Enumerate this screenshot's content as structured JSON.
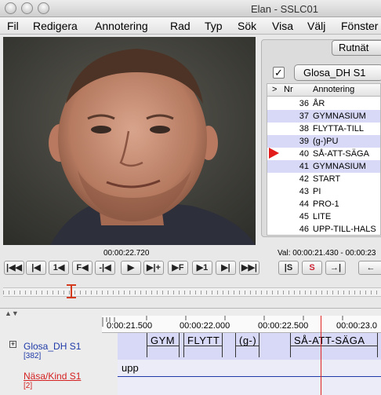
{
  "window": {
    "title": "Elan - SSLC01"
  },
  "menu": [
    "Fil",
    "Redigera",
    "Annotering",
    "Rad",
    "Typ",
    "Sök",
    "Visa",
    "Välj",
    "Fönster"
  ],
  "panel": {
    "tab_label": "Rutnät",
    "checkbox_mark": "✓",
    "tier_select": "Glosa_DH S1",
    "columns": {
      "marker": ">",
      "nr": "Nr",
      "annotation": "Annotering"
    },
    "rows": [
      {
        "nr": "36",
        "annotation": "ÅR"
      },
      {
        "nr": "37",
        "annotation": "GYMNASIUM"
      },
      {
        "nr": "38",
        "annotation": "FLYTTA-TILL"
      },
      {
        "nr": "39",
        "annotation": "(g-)PU"
      },
      {
        "nr": "40",
        "annotation": "SÅ-ATT-SÄGA"
      },
      {
        "nr": "41",
        "annotation": "GYMNASIUM"
      },
      {
        "nr": "42",
        "annotation": "START"
      },
      {
        "nr": "43",
        "annotation": "PI"
      },
      {
        "nr": "44",
        "annotation": "PRO-1"
      },
      {
        "nr": "45",
        "annotation": "LITE"
      },
      {
        "nr": "46",
        "annotation": "UPP-TILL-HALS"
      }
    ],
    "active_row": "40"
  },
  "media": {
    "current_time": "00:00:22.720",
    "selection": "Val: 00:00:21.430 - 00:00:23"
  },
  "controls": {
    "frame_back_label": "F",
    "frame_forward_label": "F",
    "one_back_label": "1",
    "one_forward_label": "1",
    "sel_s_label": "S",
    "sel_s2_label": "S"
  },
  "timeline": {
    "ruler_ticks": [
      "0:00:21.500",
      "00:00:22.000",
      "00:00:22.500",
      "00:00:23.0"
    ],
    "tiers": [
      {
        "name": "Glosa_DH S1",
        "count": "[382]",
        "color": "#1f3aa8"
      },
      {
        "name": "Näsa/Kind S1",
        "count": "[2]",
        "color": "#d42020"
      }
    ],
    "segments": [
      "GYM",
      "FLYTT",
      "(g-)",
      "SÅ-ATT-SÄGA"
    ],
    "tier2_text": "upp"
  },
  "colors": {
    "accent_red": "#e0241f",
    "row_highlight": "#d7d9f6"
  }
}
